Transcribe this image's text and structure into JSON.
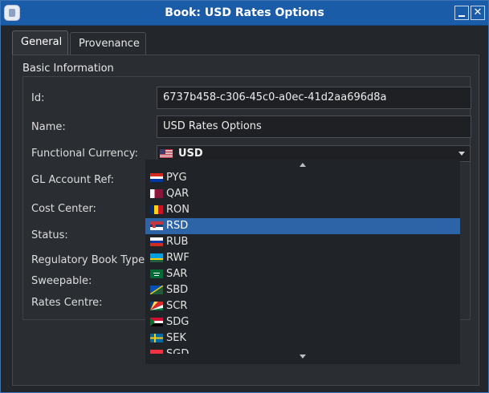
{
  "window": {
    "title": "Book: USD Rates Options",
    "minimize_label": "",
    "close_label": "✕"
  },
  "tabs": [
    {
      "label": "General",
      "active": true
    },
    {
      "label": "Provenance",
      "active": false
    }
  ],
  "basic_info": {
    "title": "Basic Information",
    "id_label": "Id:",
    "id_value": "6737b458-c306-45c0-a0ec-41d2aa696d8a",
    "name_label": "Name:",
    "name_value": "USD Rates Options",
    "functional_currency_label": "Functional Currency:",
    "functional_currency_value": "USD",
    "functional_currency_flag": "flag-us-icon",
    "gl_account_label": "GL Account Ref:",
    "cost_center_label": "Cost Center:",
    "status_label": "Status:",
    "regulatory_book_type_label": "Regulatory Book Type:",
    "sweepable_label": "Sweepable:",
    "rates_centre_label": "Rates Centre:"
  },
  "currency_dropdown": {
    "options": [
      {
        "code": "PYG",
        "flag": "flag-py-icon"
      },
      {
        "code": "QAR",
        "flag": "flag-qa-icon"
      },
      {
        "code": "RON",
        "flag": "flag-ro-icon"
      },
      {
        "code": "RSD",
        "flag": "flag-rs-icon",
        "selected": true
      },
      {
        "code": "RUB",
        "flag": "flag-ru-icon"
      },
      {
        "code": "RWF",
        "flag": "flag-rw-icon"
      },
      {
        "code": "SAR",
        "flag": "flag-sa-icon"
      },
      {
        "code": "SBD",
        "flag": "flag-sb-icon"
      },
      {
        "code": "SCR",
        "flag": "flag-sc-icon"
      },
      {
        "code": "SDG",
        "flag": "flag-sd-icon"
      },
      {
        "code": "SEK",
        "flag": "flag-se-icon"
      },
      {
        "code": "SGD",
        "flag": "flag-sg-icon"
      }
    ]
  },
  "colors": {
    "titlebar": "#1b5ca8",
    "selection": "#2d64a8",
    "background": "#23262a"
  }
}
